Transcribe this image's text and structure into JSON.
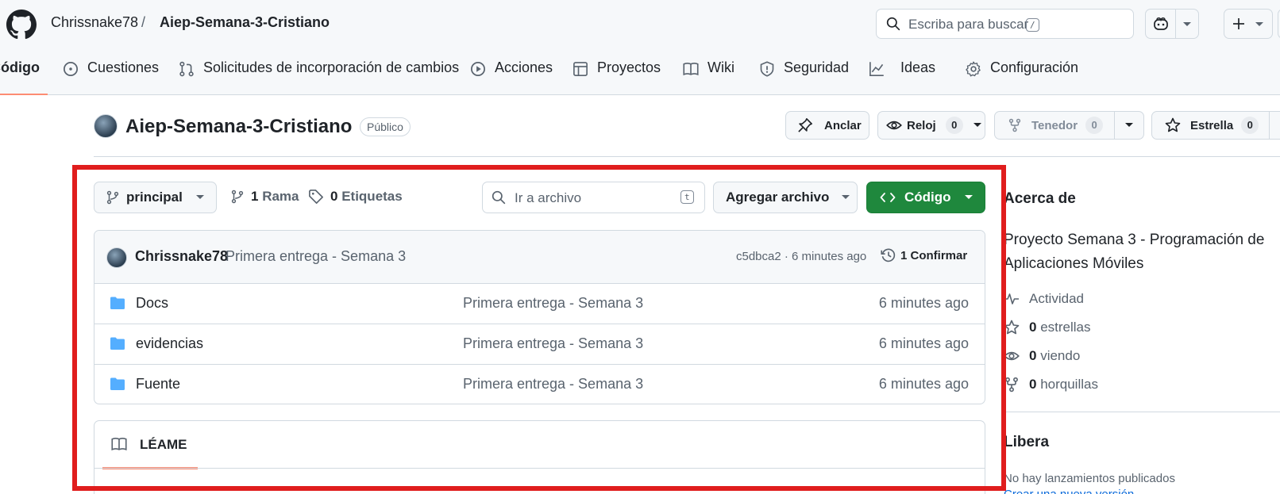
{
  "header": {
    "owner": "Chrissnake78",
    "separator": "/",
    "repo": "Aiep-Semana-3-Cristiano",
    "search_placeholder": "Escriba para buscar",
    "search_shortcut": "/"
  },
  "tabs": [
    {
      "label": "Código",
      "icon": "code-icon"
    },
    {
      "label": "Cuestiones",
      "icon": "issue-icon"
    },
    {
      "label": "Solicitudes de incorporación de cambios",
      "icon": "pull-request-icon"
    },
    {
      "label": "Acciones",
      "icon": "play-icon"
    },
    {
      "label": "Proyectos",
      "icon": "table-icon"
    },
    {
      "label": "Wiki",
      "icon": "book-icon"
    },
    {
      "label": "Seguridad",
      "icon": "shield-icon"
    },
    {
      "label": "Ideas",
      "icon": "graph-icon"
    },
    {
      "label": "Configuración",
      "icon": "gear-icon"
    }
  ],
  "repo_header": {
    "title": "Aiep-Semana-3-Cristiano",
    "visibility": "Público",
    "pin_label": "Anclar",
    "watch_label": "Reloj",
    "watch_count": "0",
    "fork_label": "Tenedor",
    "fork_count": "0",
    "star_label": "Estrella",
    "star_count": "0"
  },
  "toolbar": {
    "branch": "principal",
    "branches_count": "1",
    "branches_label": "Rama",
    "tags_count": "0",
    "tags_label": "Etiquetas",
    "goto_placeholder": "Ir a archivo",
    "goto_shortcut": "t",
    "add_file": "Agregar archivo",
    "code_button": "Código"
  },
  "commit": {
    "author": "Chrissnake78",
    "message": "Primera entrega - Semana 3",
    "hash_time": "c5dbca2 · 6 minutes ago",
    "commits_label": "1 Confirmar"
  },
  "files": [
    {
      "name": "Docs",
      "message": "Primera entrega - Semana 3",
      "date": "6 minutes ago"
    },
    {
      "name": "evidencias",
      "message": "Primera entrega - Semana 3",
      "date": "6 minutes ago"
    },
    {
      "name": "Fuente",
      "message": "Primera entrega - Semana 3",
      "date": "6 minutes ago"
    }
  ],
  "readme": {
    "tab_label": "LÉAME"
  },
  "sidebar": {
    "about_title": "Acerca de",
    "description": "Proyecto Semana 3 - Programación de Aplicaciones Móviles",
    "activity": "Actividad",
    "stars_count": "0",
    "stars_label": "estrellas",
    "watching_count": "0",
    "watching_label": "viendo",
    "forks_count": "0",
    "forks_label": "horquillas",
    "releases_title": "Libera",
    "no_releases": "No hay lanzamientos publicados",
    "create_release": "Crear una nueva versión"
  },
  "colors": {
    "accent_green": "#1f883d",
    "folder_blue": "#54aeff",
    "tab_underline": "#fd8c73",
    "highlight_frame": "#e01d1d"
  }
}
